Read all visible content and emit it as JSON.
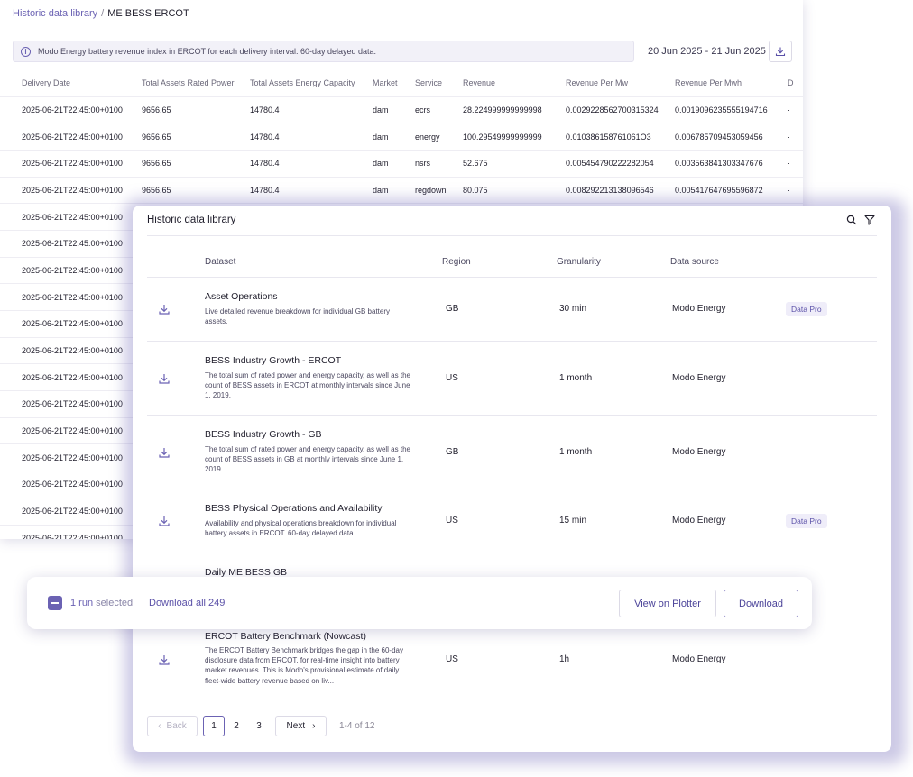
{
  "breadcrumb": {
    "parent": "Historic data library",
    "separator": "/",
    "current": "ME BESS ERCOT"
  },
  "banner": {
    "text": "Modo Energy battery revenue index in ERCOT for each delivery interval. 60-day delayed data."
  },
  "date_range": "20 Jun 2025 - 21 Jun 2025",
  "table": {
    "columns": [
      "Delivery Date",
      "Total Assets Rated Power",
      "Total Assets Energy Capacity",
      "Market",
      "Service",
      "Revenue",
      "Revenue Per Mw",
      "Revenue Per Mwh",
      "D"
    ],
    "rows": [
      [
        "2025-06-21T22:45:00+0100",
        "9656.65",
        "14780.4",
        "dam",
        "ecrs",
        "28.224999999999998",
        "0.0029228562700315324",
        "0.0019096235555194716",
        "·"
      ],
      [
        "2025-06-21T22:45:00+0100",
        "9656.65",
        "14780.4",
        "dam",
        "energy",
        "100.29549999999999",
        "0.010386158761061O3",
        "0.006785709453059456",
        "·"
      ],
      [
        "2025-06-21T22:45:00+0100",
        "9656.65",
        "14780.4",
        "dam",
        "nsrs",
        "52.675",
        "0.005454790222282054",
        "0.003563841303347676",
        "·"
      ],
      [
        "2025-06-21T22:45:00+0100",
        "9656.65",
        "14780.4",
        "dam",
        "regdown",
        "80.075",
        "0.008292213138096546",
        "0.005417647695596872",
        "·"
      ],
      [
        "2025-06-21T22:45:00+0100",
        "",
        "",
        "",
        "",
        "",
        "",
        "",
        ""
      ],
      [
        "2025-06-21T22:45:00+0100",
        "",
        "",
        "",
        "",
        "",
        "",
        "",
        ""
      ],
      [
        "2025-06-21T22:45:00+0100",
        "",
        "",
        "",
        "",
        "",
        "",
        "",
        ""
      ],
      [
        "2025-06-21T22:45:00+0100",
        "",
        "",
        "",
        "",
        "",
        "",
        "",
        ""
      ],
      [
        "2025-06-21T22:45:00+0100",
        "",
        "",
        "",
        "",
        "",
        "",
        "",
        ""
      ],
      [
        "2025-06-21T22:45:00+0100",
        "",
        "",
        "",
        "",
        "",
        "",
        "",
        ""
      ],
      [
        "2025-06-21T22:45:00+0100",
        "",
        "",
        "",
        "",
        "",
        "",
        "",
        ""
      ],
      [
        "2025-06-21T22:45:00+0100",
        "",
        "",
        "",
        "",
        "",
        "",
        "",
        ""
      ],
      [
        "2025-06-21T22:45:00+0100",
        "",
        "",
        "",
        "",
        "",
        "",
        "",
        ""
      ],
      [
        "2025-06-21T22:45:00+0100",
        "",
        "",
        "",
        "",
        "",
        "",
        "",
        ""
      ],
      [
        "2025-06-21T22:45:00+0100",
        "",
        "",
        "",
        "",
        "",
        "",
        "",
        ""
      ],
      [
        "2025-06-21T22:45:00+0100",
        "",
        "",
        "",
        "",
        "",
        "",
        "",
        ""
      ],
      [
        "2025-06-21T22:45:00+0100",
        "",
        "",
        "",
        "",
        "",
        "",
        "",
        ""
      ]
    ]
  },
  "library": {
    "title": "Historic data library",
    "columns": {
      "dataset": "Dataset",
      "region": "Region",
      "granularity": "Granularity",
      "source": "Data source"
    },
    "datasets": [
      {
        "title": "Asset Operations",
        "description": "Live detailed revenue breakdown for individual GB battery assets.",
        "region": "GB",
        "granularity": "30 min",
        "source": "Modo Energy",
        "badge": "Data Pro"
      },
      {
        "title": "BESS Industry Growth - ERCOT",
        "description": "The total sum of rated power and energy capacity, as well as the count of BESS assets in ERCOT at monthly intervals since June 1, 2019.",
        "region": "US",
        "granularity": "1 month",
        "source": "Modo Energy",
        "badge": ""
      },
      {
        "title": "BESS Industry Growth - GB",
        "description": "The total sum of rated power and energy capacity, as well as the count of BESS assets in GB at monthly intervals since June 1, 2019.",
        "region": "GB",
        "granularity": "1 month",
        "source": "Modo Energy",
        "badge": ""
      },
      {
        "title": "BESS Physical Operations and Availability",
        "description": "Availability and physical operations breakdown for individual battery assets in ERCOT. 60-day delayed data.",
        "region": "US",
        "granularity": "15 min",
        "source": "Modo Energy",
        "badge": "Data Pro"
      },
      {
        "title": "Daily ME BESS GB",
        "description": "",
        "region": "",
        "granularity": "",
        "source": "",
        "badge": ""
      },
      {
        "title": "ERCOT Battery Benchmark (Nowcast)",
        "description": "The ERCOT Battery Benchmark bridges the gap in the 60-day disclosure data from ERCOT, for real-time insight into battery market revenues. This is Modo's provisional estimate of daily fleet-wide battery revenue based on liv...",
        "region": "US",
        "granularity": "1h",
        "source": "Modo Energy",
        "badge": ""
      }
    ],
    "pagination": {
      "back": "Back",
      "pages": [
        "1",
        "2",
        "3"
      ],
      "current": "1",
      "next": "Next",
      "range": "1-4 of 12"
    }
  },
  "selection": {
    "count_text": "1 run",
    "selected_text": "selected",
    "download_all": "Download all 249",
    "view_on_plotter": "View on Plotter",
    "download": "Download"
  },
  "colors": {
    "accent": "#6b62b3",
    "badge_bg": "#efedf9",
    "text": "#1f1d2b"
  }
}
